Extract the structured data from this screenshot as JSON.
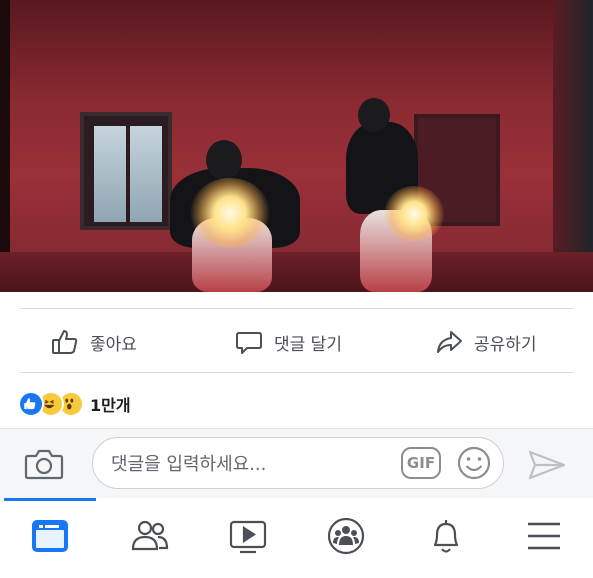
{
  "post": {
    "photo_icon": "photo"
  },
  "actions": {
    "like_label": "좋아요",
    "comment_label": "댓글 달기",
    "share_label": "공유하기"
  },
  "reactions": {
    "icons": [
      "like-icon",
      "haha-icon",
      "wow-icon"
    ],
    "count": "1만개"
  },
  "comment_bar": {
    "placeholder": "댓글을 입력하세요...",
    "gif_label": "GIF"
  },
  "nav": {
    "items": [
      "news-feed-icon",
      "friends-icon",
      "watch-icon",
      "groups-icon",
      "notifications-icon",
      "menu-icon"
    ],
    "active": "news-feed-icon"
  },
  "colors": {
    "accent": "#1877f2",
    "icon_gray": "#4b4f56",
    "reaction_yellow": "#f7c93b"
  }
}
